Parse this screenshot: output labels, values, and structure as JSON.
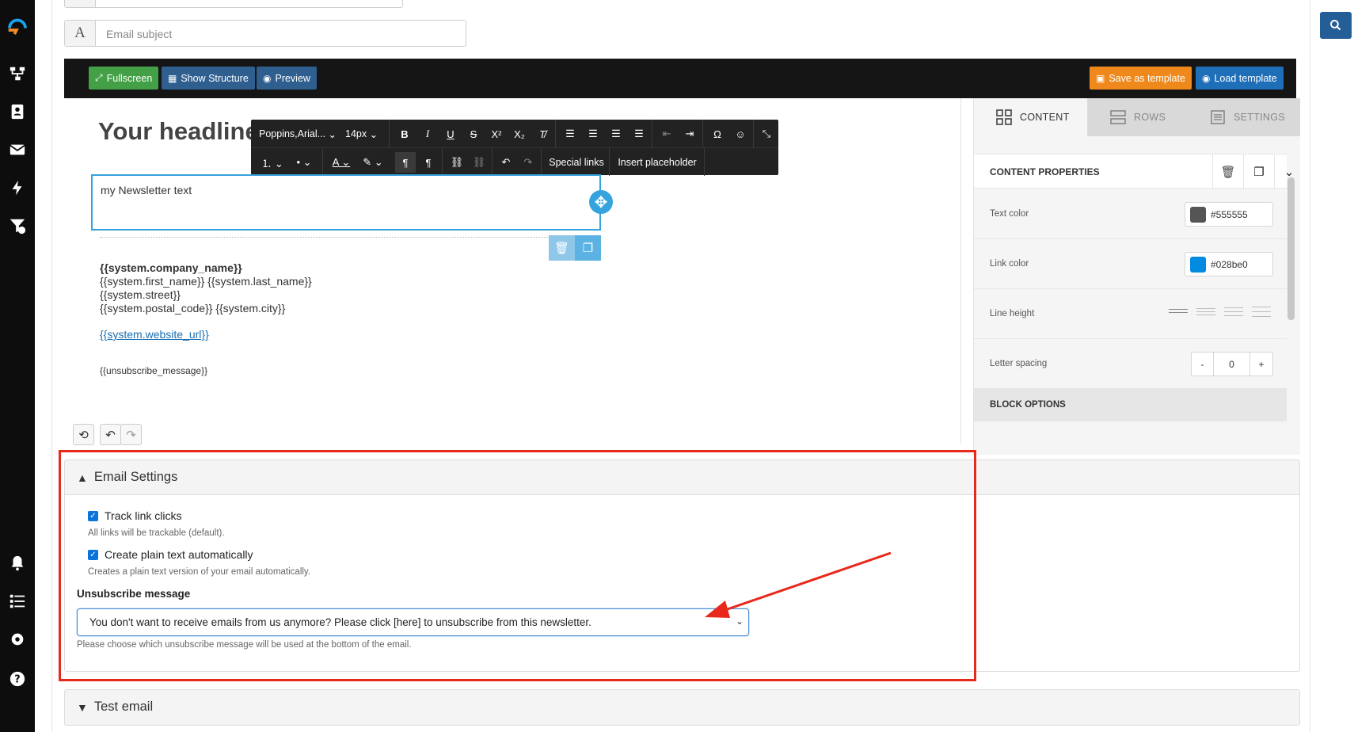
{
  "header_inputs": {
    "subject_addon": "A",
    "subject_placeholder": "Email subject"
  },
  "editor_bar": {
    "fullscreen": "Fullscreen",
    "show_structure": "Show Structure",
    "preview": "Preview",
    "save_template": "Save as template",
    "load_template": "Load template"
  },
  "colors": {
    "fullscreen_bg": "#43a047",
    "structure_bg": "#2f5f8f",
    "save_bg": "#f0891b",
    "load_bg": "#1f6eb8",
    "accent_blue": "#35a3de",
    "highlight_red": "#e8281a"
  },
  "rt_toolbar": {
    "font": "Poppins,Arial...",
    "size": "14px",
    "special_links": "Special links",
    "insert_placeholder": "Insert placeholder"
  },
  "canvas": {
    "headline": "Your headline",
    "newsletter_text": "my Newsletter text",
    "company": "{{system.company_name}}",
    "name": "{{system.first_name}} {{system.last_name}}",
    "street": "{{system.street}}",
    "city": "{{system.postal_code}} {{system.city}}",
    "website": "{{system.website_url}}",
    "unsubscribe_placeholder": "{{unsubscribe_message}}"
  },
  "right_panel": {
    "tabs": [
      "CONTENT",
      "ROWS",
      "SETTINGS"
    ],
    "content_properties": "CONTENT PROPERTIES",
    "text_color_label": "Text color",
    "text_color_value": "#555555",
    "link_color_label": "Link color",
    "link_color_value": "#028be0",
    "line_height_label": "Line height",
    "letter_spacing_label": "Letter spacing",
    "letter_spacing_minus": "-",
    "letter_spacing_value": "0",
    "letter_spacing_plus": "+",
    "block_options": "BLOCK OPTIONS"
  },
  "email_settings": {
    "title": "Email Settings",
    "track_label": "Track link clicks",
    "track_checked": true,
    "track_help": "All links will be trackable (default).",
    "plain_label": "Create plain text automatically",
    "plain_checked": true,
    "plain_help": "Creates a plain text version of your email automatically.",
    "unsub_label": "Unsubscribe message",
    "unsub_value": "You don't want to receive emails from us anymore? Please click [here] to unsubscribe from this newsletter.",
    "unsub_help": "Please choose which unsubscribe message will be used at the bottom of the email."
  },
  "test_email": {
    "title": "Test email"
  }
}
